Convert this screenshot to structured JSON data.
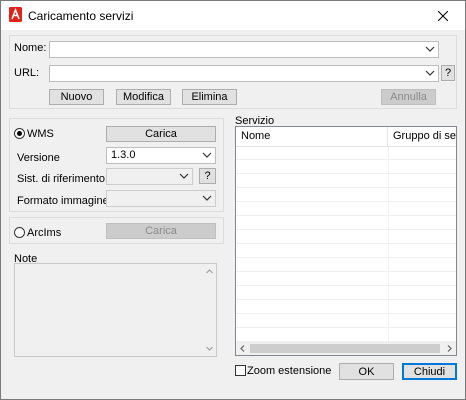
{
  "window": {
    "title": "Caricamento servizi",
    "close_icon": "close-icon",
    "app_icon": "autocad-icon",
    "accent_color": "#e2231a"
  },
  "top": {
    "nome_label": "Nome:",
    "nome_value": "",
    "url_label": "URL:",
    "url_value": "",
    "help_label": "?",
    "buttons": {
      "nuovo": "Nuovo",
      "modifica": "Modifica",
      "elimina": "Elimina",
      "annulla": "Annulla"
    }
  },
  "wms": {
    "radio_label": "WMS",
    "selected": true,
    "carica_label": "Carica",
    "versione_label": "Versione",
    "versione_value": "1.3.0",
    "sist_label": "Sist. di riferimento",
    "sist_value": "",
    "help_label": "?",
    "formato_label": "Formato immagine",
    "formato_value": ""
  },
  "arcims": {
    "radio_label": "ArcIms",
    "selected": false,
    "carica_label": "Carica"
  },
  "note": {
    "label": "Note",
    "value": ""
  },
  "servizio": {
    "label": "Servizio",
    "columns": [
      "Nome",
      "Gruppo di servizi"
    ],
    "rows": []
  },
  "footer": {
    "zoom_label": "Zoom estensione",
    "zoom_checked": false,
    "ok_label": "OK",
    "chiudi_label": "Chiudi"
  }
}
